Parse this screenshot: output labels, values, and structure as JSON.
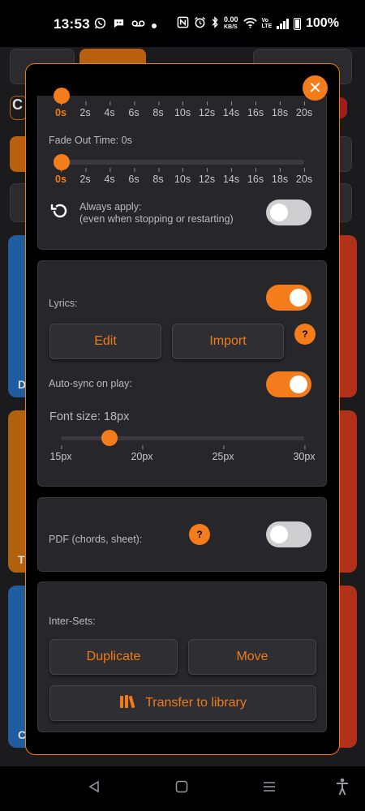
{
  "status_bar": {
    "time": "13:53",
    "net_speed_value": "0.00",
    "net_speed_unit": "KB/S",
    "volte": "Vo\nLTE",
    "battery": "100%"
  },
  "background": {
    "left_letter_1": "C",
    "left_letter_2": "D",
    "left_letter_3": "T",
    "left_letter_4": "C"
  },
  "close_icon": "✕",
  "fade": {
    "fade_in_ticks": [
      "0s",
      "2s",
      "4s",
      "6s",
      "8s",
      "10s",
      "12s",
      "14s",
      "16s",
      "18s",
      "20s"
    ],
    "fade_in_value": "0s",
    "fade_out_label": "Fade Out Time: 0s",
    "fade_out_ticks": [
      "0s",
      "2s",
      "4s",
      "6s",
      "8s",
      "10s",
      "12s",
      "14s",
      "16s",
      "18s",
      "20s"
    ],
    "fade_out_value": "0s",
    "always_apply_line1": "Always apply:",
    "always_apply_line2": "(even when stopping or restarting)",
    "always_apply_on": false
  },
  "lyrics": {
    "label": "Lyrics:",
    "enabled": true,
    "edit_label": "Edit",
    "import_label": "Import",
    "help": "?",
    "autosync_label": "Auto-sync on play:",
    "autosync_on": true,
    "font_size_label": "Font size: 18px",
    "font_ticks": [
      "15px",
      "20px",
      "25px",
      "30px"
    ],
    "font_size_value": 18
  },
  "pdf": {
    "label": "PDF (chords, sheet):",
    "help": "?",
    "enabled": false
  },
  "intersets": {
    "label": "Inter-Sets:",
    "duplicate_label": "Duplicate",
    "move_label": "Move",
    "transfer_label": "Transfer to library"
  },
  "colors": {
    "accent": "#f47c1a",
    "panel": "#26262b",
    "modal_bg": "#000000"
  }
}
